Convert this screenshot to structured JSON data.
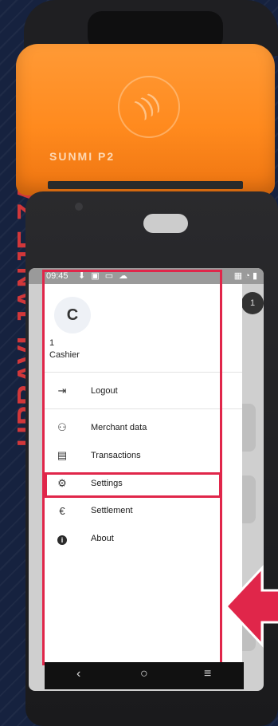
{
  "side_banner": {
    "text": "UPRAVLJANJE ZASLON"
  },
  "device": {
    "brand": "SUNMI P2"
  },
  "status_bar": {
    "time": "09:45",
    "left_icons": "⬇ ▣ ▭ ☁",
    "right_icons": "▦ ◔ ▮"
  },
  "background_badge": "1",
  "profile": {
    "avatar_letter": "C",
    "user_id": "1",
    "role": "Cashier"
  },
  "menu": {
    "logout": {
      "label": "Logout",
      "icon": "logout-icon"
    },
    "merchant_data": {
      "label": "Merchant data",
      "icon": "merchant-icon"
    },
    "transactions": {
      "label": "Transactions",
      "icon": "transactions-icon"
    },
    "settings": {
      "label": "Settings",
      "icon": "gear-icon"
    },
    "settlement": {
      "label": "Settlement",
      "icon": "euro-icon"
    },
    "about": {
      "label": "About",
      "icon": "info-icon"
    }
  },
  "nav": {
    "back": "‹",
    "home": "○",
    "menu": "≡"
  },
  "colors": {
    "highlight": "#e0264a",
    "printer_orange": "#ff8a1e",
    "background": "#16223f"
  }
}
